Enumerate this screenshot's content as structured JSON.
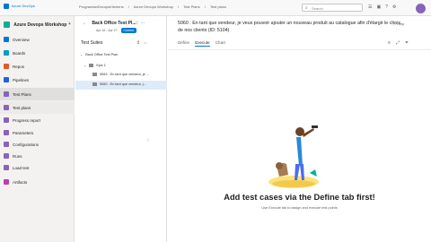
{
  "topbar": {
    "brand": "Azure DevOps",
    "crumbs": [
      "ProgramlabDevopsKitchens",
      "/",
      "Azure Devops Workshop",
      "/",
      "Test Plans",
      "/",
      "Test plans"
    ],
    "search_placeholder": "Search"
  },
  "sidebar": {
    "org": "Azure Devops Workshop",
    "items": [
      {
        "label": "Overview",
        "color": "#0078d4"
      },
      {
        "label": "Boards",
        "color": "#009ccc"
      },
      {
        "label": "Repos",
        "color": "#e05a24"
      },
      {
        "label": "Pipelines",
        "color": "#2560e0"
      },
      {
        "label": "Test Plans",
        "color": "#8764b8"
      },
      {
        "label": "Test plans",
        "color": "#8764b8"
      },
      {
        "label": "Progress report",
        "color": "#8764b8"
      },
      {
        "label": "Parameters",
        "color": "#8764b8"
      },
      {
        "label": "Configurations",
        "color": "#8764b8"
      },
      {
        "label": "Runs",
        "color": "#8764b8"
      },
      {
        "label": "Load test",
        "color": "#8764b8"
      },
      {
        "label": "Artifacts",
        "color": "#c239b3"
      }
    ]
  },
  "panel": {
    "plan_title": "Back Office Test Pl...",
    "plan_dates": "Apr 16 - Apr 27",
    "plan_status": "Current",
    "suites_heading": "Test Suites",
    "tree": [
      "Back Office Test Plan",
      "Epic 1",
      "5063 : En tant que vendeur, je ...",
      "5060 : En tant que vendeur, j..."
    ]
  },
  "main": {
    "work_item_title": "5060 : En tant que vendeur, je veux pouvoir ajouter un nouveau produit au catalogue afin d'élargir le choix de nos clients (ID: 5104)",
    "help": "Help",
    "tabs": [
      "Define",
      "Execute",
      "Chart"
    ],
    "active_tab": "Execute",
    "empty_title": "Add test cases via the Define tab first!",
    "empty_subtitle": "Use Execute tab to assign and execute test points"
  }
}
